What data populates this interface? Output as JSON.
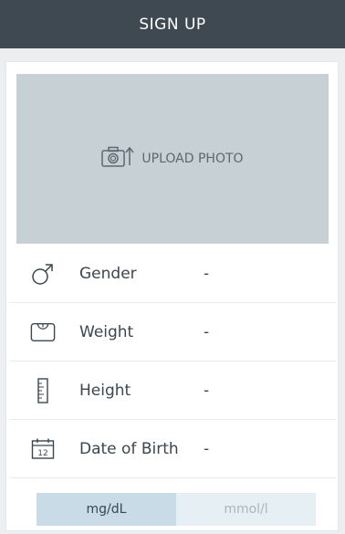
{
  "header": {
    "title": "SIGN UP"
  },
  "photo": {
    "label": "UPLOAD PHOTO",
    "icon": "camera-rotate-icon"
  },
  "fields": [
    {
      "label": "Gender",
      "value": "-",
      "icon": "male-icon"
    },
    {
      "label": "Weight",
      "value": "-",
      "icon": "scale-icon"
    },
    {
      "label": "Height",
      "value": "-",
      "icon": "ruler-icon"
    },
    {
      "label": "Date of Birth",
      "value": "-",
      "icon": "calendar-icon",
      "icon_text": "12"
    }
  ],
  "units": {
    "options": [
      "mg/dL",
      "mmol/l"
    ],
    "selected": "mg/dL"
  },
  "colors": {
    "header": "#3e4952",
    "photo_bg": "#c7d0d5",
    "unit_active": "#c9dbe7",
    "unit_inactive": "#e6eff4"
  }
}
